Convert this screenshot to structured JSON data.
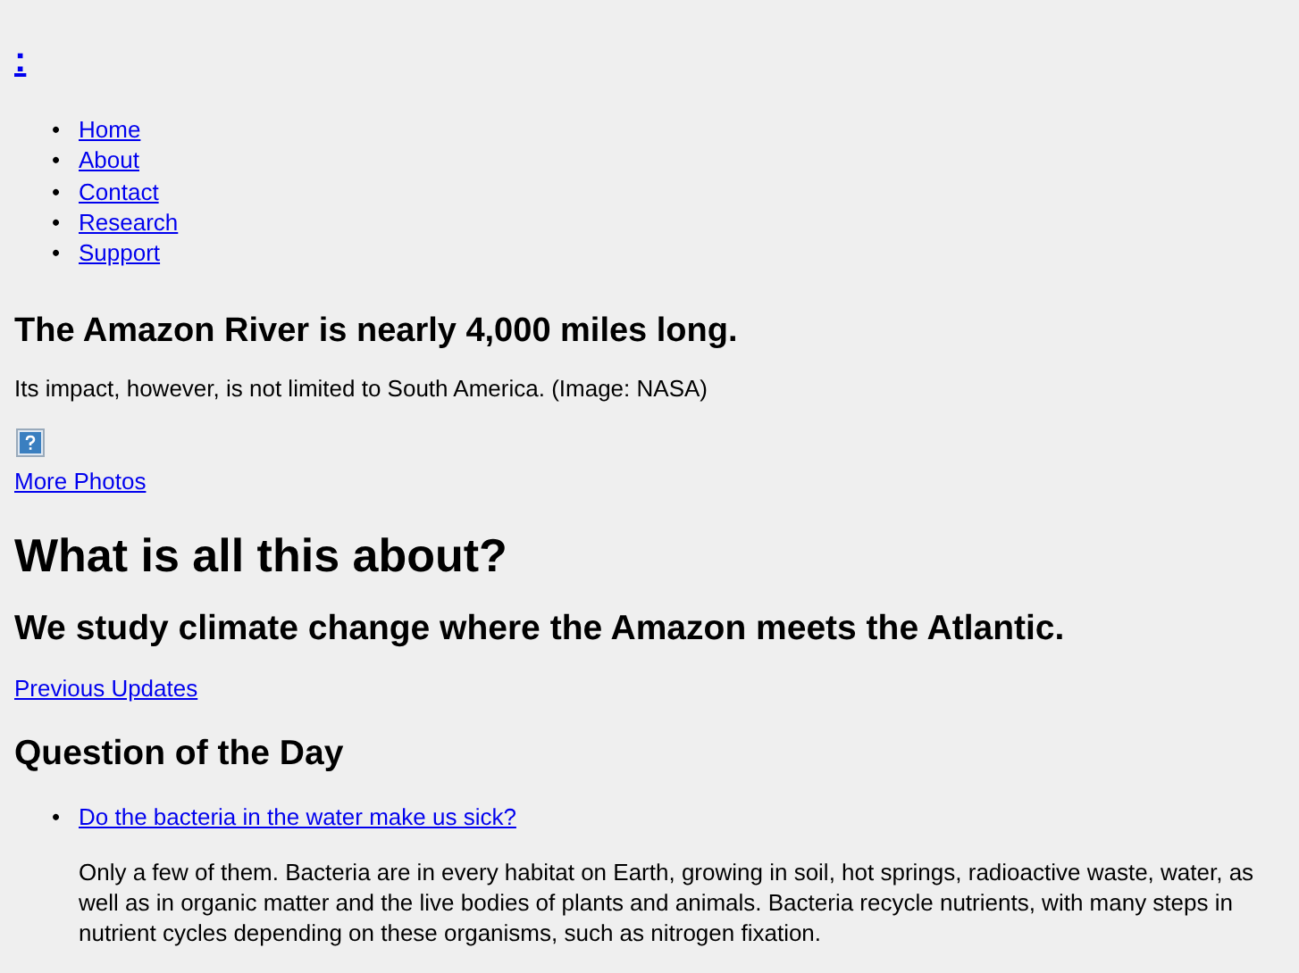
{
  "site_link": ":",
  "nav": [
    {
      "bullet": "•",
      "label": "Home"
    },
    {
      "bullet": "•",
      "label": "About"
    },
    {
      "bullet": "•",
      "label": "Contact"
    },
    {
      "bullet": "•",
      "label": "Research"
    },
    {
      "bullet": "•",
      "label": "Support"
    }
  ],
  "feature": {
    "title": "The Amazon River is nearly 4,000 miles long.",
    "caption": "Its impact, however, is not limited to South America. (Image: NASA)",
    "more_link": "More Photos"
  },
  "intro": {
    "title": "What is all this about?",
    "subtitle": "We study climate change where the Amazon meets the Atlantic.",
    "link": "Previous Updates"
  },
  "qotd": {
    "title": "Question of the Day",
    "items": [
      {
        "bullet": "•",
        "question": "Do the bacteria in the water make us sick?",
        "answer": "Only a few of them.  Bacteria are in every habitat on Earth, growing in soil, hot springs, radioactive waste, water, as well as in organic matter and the live bodies of plants and animals. Bacteria recycle nutrients, with many steps in nutrient cycles depending on these organisms, such as nitrogen fixation."
      }
    ]
  }
}
